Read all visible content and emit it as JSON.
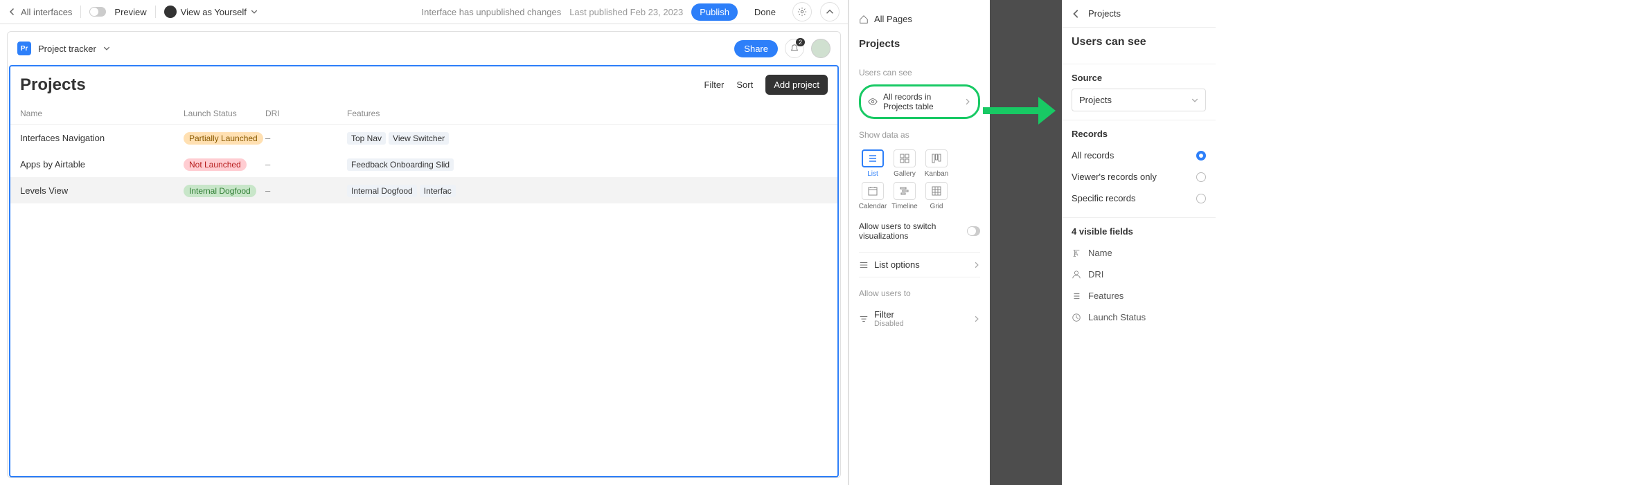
{
  "topbar": {
    "back_label": "All interfaces",
    "preview_label": "Preview",
    "view_as_label": "View as Yourself",
    "unpublished_msg": "Interface has unpublished changes",
    "last_published": "Last published Feb 23, 2023",
    "publish_label": "Publish",
    "done_label": "Done"
  },
  "card": {
    "app_icon_text": "Pr",
    "app_name": "Project tracker",
    "share_label": "Share",
    "bell_badge": "2"
  },
  "content": {
    "title": "Projects",
    "filter_label": "Filter",
    "sort_label": "Sort",
    "add_label": "Add project",
    "columns": {
      "name": "Name",
      "status": "Launch Status",
      "dri": "DRI",
      "features": "Features"
    },
    "rows": [
      {
        "name": "Interfaces Navigation",
        "status": "Partially Launched",
        "status_class": "pill-orange",
        "dri": "–",
        "features": [
          "Top Nav",
          "View Switcher"
        ]
      },
      {
        "name": "Apps by Airtable",
        "status": "Not Launched",
        "status_class": "pill-red",
        "dri": "–",
        "features": [
          "Feedback Onboarding Slid"
        ]
      },
      {
        "name": "Levels View",
        "status": "Internal Dogfood",
        "status_class": "pill-green",
        "dri": "–",
        "features": [
          "Internal Dogfood",
          "Interfac"
        ]
      }
    ]
  },
  "config": {
    "all_pages": "All Pages",
    "page_title": "Projects",
    "users_can_see": "Users can see",
    "records_text": "All records in Projects table",
    "show_data_as": "Show data as",
    "viz": [
      {
        "key": "list",
        "label": "List"
      },
      {
        "key": "gallery",
        "label": "Gallery"
      },
      {
        "key": "kanban",
        "label": "Kanban"
      },
      {
        "key": "calendar",
        "label": "Calendar"
      },
      {
        "key": "timeline",
        "label": "Timeline"
      },
      {
        "key": "grid",
        "label": "Grid"
      }
    ],
    "allow_switch": "Allow users to switch visualizations",
    "list_options": "List options",
    "allow_users_to": "Allow users to",
    "filter_label": "Filter",
    "filter_status": "Disabled"
  },
  "detail": {
    "back_label": "Projects",
    "title": "Users can see",
    "source_label": "Source",
    "source_value": "Projects",
    "records_label": "Records",
    "record_options": [
      {
        "label": "All records",
        "checked": true
      },
      {
        "label": "Viewer's records only",
        "checked": false
      },
      {
        "label": "Specific records",
        "checked": false
      }
    ],
    "fields_label": "4 visible fields",
    "fields": [
      {
        "icon": "text",
        "label": "Name"
      },
      {
        "icon": "user",
        "label": "DRI"
      },
      {
        "icon": "list",
        "label": "Features"
      },
      {
        "icon": "clock",
        "label": "Launch Status"
      }
    ]
  },
  "colors": {
    "accent": "#2d7ff9",
    "highlight_green": "#18c964"
  }
}
